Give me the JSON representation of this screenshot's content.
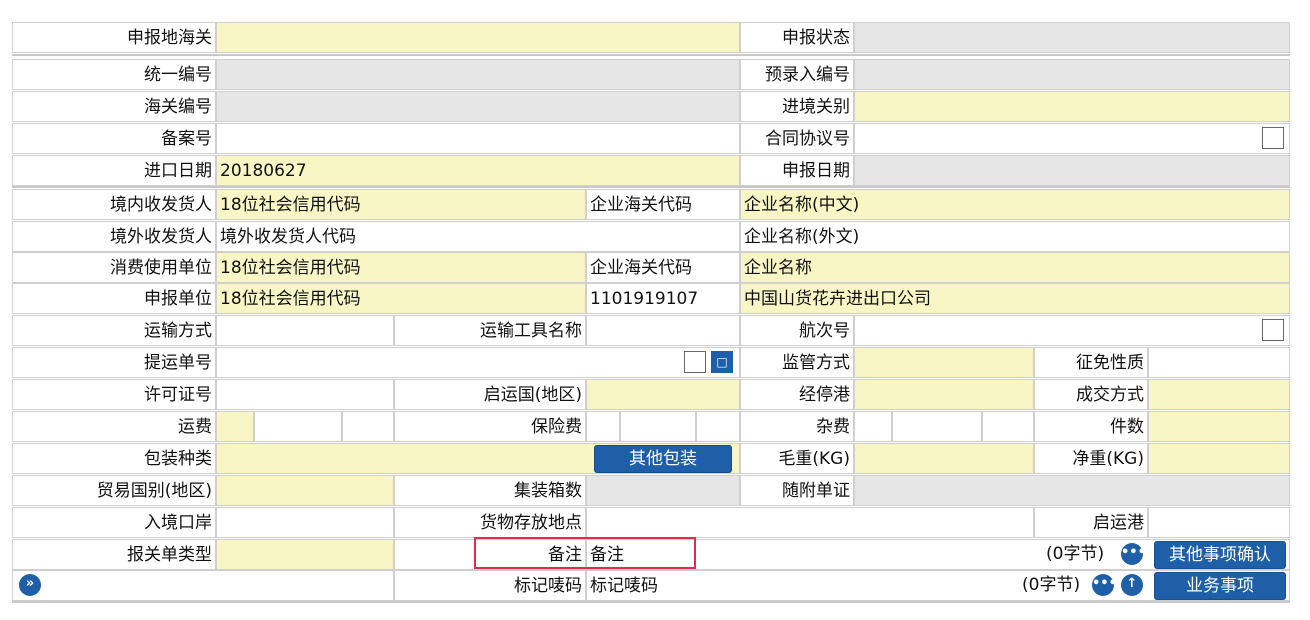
{
  "row1": {
    "customs_label": "申报地海关",
    "status_label": "申报状态"
  },
  "row2": {
    "unified_no_label": "统一编号",
    "pre_entry_label": "预录入编号"
  },
  "row3": {
    "customs_no_label": "海关编号",
    "ie_port_label": "进境关别"
  },
  "row4": {
    "record_no_label": "备案号",
    "contract_label": "合同协议号"
  },
  "row5": {
    "import_date_label": "进口日期",
    "import_date_value": "20180627",
    "declare_date_label": "申报日期"
  },
  "consignee": {
    "label": "境内收发货人",
    "code_placeholder": "18位社会信用代码",
    "customs_code_label": "企业海关代码",
    "name_placeholder": "企业名称(中文)"
  },
  "foreign": {
    "label": "境外收发货人",
    "code_placeholder": "境外收发货人代码",
    "name_placeholder": "企业名称(外文)"
  },
  "consumer": {
    "label": "消费使用单位",
    "code_placeholder": "18位社会信用代码",
    "customs_code_label": "企业海关代码",
    "name_placeholder": "企业名称"
  },
  "declarant": {
    "label": "申报单位",
    "code_placeholder": "18位社会信用代码",
    "customs_code": "1101919107",
    "name": "中国山货花卉进出口公司"
  },
  "transport": {
    "mode_label": "运输方式",
    "tool_label": "运输工具名称",
    "voyage_label": "航次号"
  },
  "bill": {
    "label": "提运单号",
    "supervision_label": "监管方式",
    "tax_label": "征免性质"
  },
  "license": {
    "label": "许可证号",
    "origin_label": "启运国(地区)",
    "port_label": "经停港",
    "deal_label": "成交方式"
  },
  "fees": {
    "freight_label": "运费",
    "insurance_label": "保险费",
    "misc_label": "杂费",
    "pieces_label": "件数"
  },
  "packing": {
    "label": "包装种类",
    "other_button": "其他包装",
    "gross_label": "毛重(KG)",
    "net_label": "净重(KG)"
  },
  "trade": {
    "label": "贸易国别(地区)",
    "container_label": "集装箱数",
    "docs_label": "随附单证"
  },
  "entry": {
    "port_label": "入境口岸",
    "storage_label": "货物存放地点",
    "dep_port_label": "启运港"
  },
  "declaration": {
    "type_label": "报关单类型",
    "remark_label": "备注",
    "remark_placeholder": "备注",
    "remark_count": "(0字节)",
    "other_confirm_button": "其他事项确认"
  },
  "marks": {
    "label": "标记唛码",
    "placeholder": "标记唛码",
    "count": "(0字节)",
    "business_button": "业务事项"
  },
  "icons": {
    "expand": "double-chevron-right-icon",
    "more": "ellipsis-icon",
    "up": "arrow-up-icon",
    "doc": "document-icon"
  },
  "colors": {
    "yellow_field": "#f9f6c6",
    "gray_field": "#e6e6e6",
    "button_blue": "#1e5fa8",
    "highlight": "#e02c48"
  }
}
